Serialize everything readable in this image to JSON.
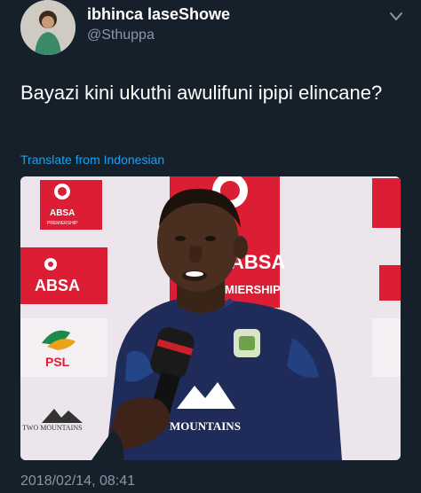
{
  "author": {
    "display_name": "ibhinca laseShowe",
    "handle": "@Sthuppa"
  },
  "tweet": {
    "text": "Bayazi kini ukuthi awulifuni ipipi elincane?",
    "translate_label": "Translate from Indonesian",
    "timestamp": "2018/02/14, 08:41"
  },
  "media": {
    "backdrop_texts": {
      "absa_premiership_small": "ABSA",
      "absa_premiership_sub": "PREMIERSHIP",
      "absa_big": "ABSA",
      "absa_right": "ABSA",
      "miership": "MIERSHIP",
      "psl": "PSL",
      "two_mountains": "TWO MOUNTAINS"
    },
    "shirt_text": "MOUNTAINS"
  },
  "colors": {
    "background": "#15202b",
    "accent_link": "#1da1f2",
    "muted_text": "#8899a6",
    "absa_red": "#dc1e35",
    "shirt_navy": "#1f2c5a"
  },
  "icons": {
    "menu": "chevron-down-icon"
  }
}
